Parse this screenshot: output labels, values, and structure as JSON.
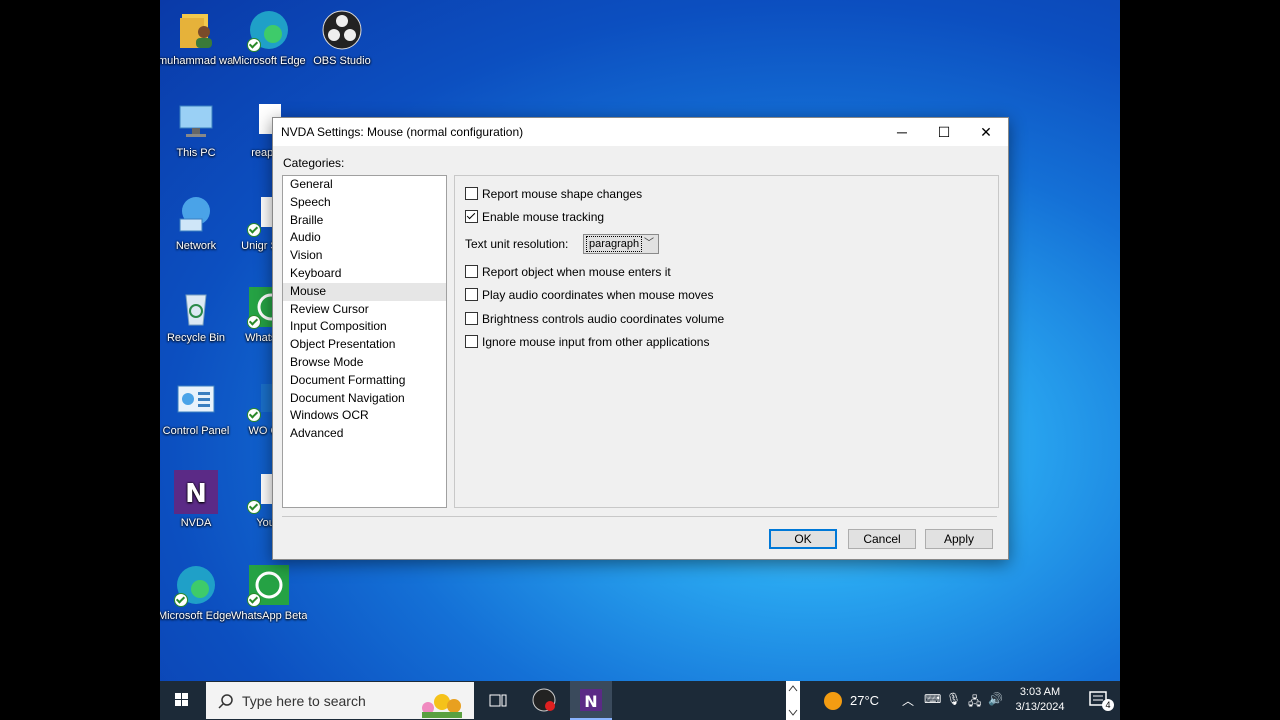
{
  "desktop": {
    "icons": [
      {
        "label": "muhammad waqas",
        "icon": "user-folder-icon"
      },
      {
        "label": "Microsoft Edge",
        "icon": "edge-icon"
      },
      {
        "label": "OBS Studio",
        "icon": "obs-icon"
      },
      {
        "label": "This PC",
        "icon": "computer-icon"
      },
      {
        "label": "reaper-",
        "icon": "file-icon"
      },
      {
        "label": "Network",
        "icon": "network-icon"
      },
      {
        "label": "Unigr Short",
        "icon": "file-icon"
      },
      {
        "label": "Recycle Bin",
        "icon": "recycle-bin-icon"
      },
      {
        "label": "Whats Be",
        "icon": "whatsapp-icon"
      },
      {
        "label": "Control Panel",
        "icon": "control-panel-icon"
      },
      {
        "label": "WO Clie",
        "icon": "app-icon"
      },
      {
        "label": "NVDA",
        "icon": "nvda-icon"
      },
      {
        "label": "YouT",
        "icon": "file-icon"
      },
      {
        "label": "Microsoft Edge - Copy",
        "icon": "edge-icon"
      },
      {
        "label": "WhatsApp Beta - S...",
        "icon": "whatsapp-icon"
      }
    ]
  },
  "dialog": {
    "title": "NVDA Settings: Mouse (normal configuration)",
    "categories_label": "Categories:",
    "categories": [
      "General",
      "Speech",
      "Braille",
      "Audio",
      "Vision",
      "Keyboard",
      "Mouse",
      "Review Cursor",
      "Input Composition",
      "Object Presentation",
      "Browse Mode",
      "Document Formatting",
      "Document Navigation",
      "Windows OCR",
      "Advanced"
    ],
    "selected_category": "Mouse",
    "options": {
      "report_shape": {
        "label": "Report mouse shape changes",
        "checked": false
      },
      "enable_tracking": {
        "label": "Enable mouse tracking",
        "checked": true
      },
      "text_unit_label": "Text unit resolution:",
      "text_unit_value": "paragraph",
      "report_object": {
        "label": "Report object when mouse enters it",
        "checked": false
      },
      "play_audio": {
        "label": "Play audio coordinates when mouse moves",
        "checked": false
      },
      "brightness": {
        "label": "Brightness controls audio coordinates volume",
        "checked": false
      },
      "ignore_input": {
        "label": "Ignore mouse input from other applications",
        "checked": false
      }
    },
    "buttons": {
      "ok": "OK",
      "cancel": "Cancel",
      "apply": "Apply"
    }
  },
  "taskbar": {
    "search_placeholder": "Type here to search",
    "weather": "27°C",
    "time": "3:03 AM",
    "date": "3/13/2024",
    "notification_count": "4"
  }
}
